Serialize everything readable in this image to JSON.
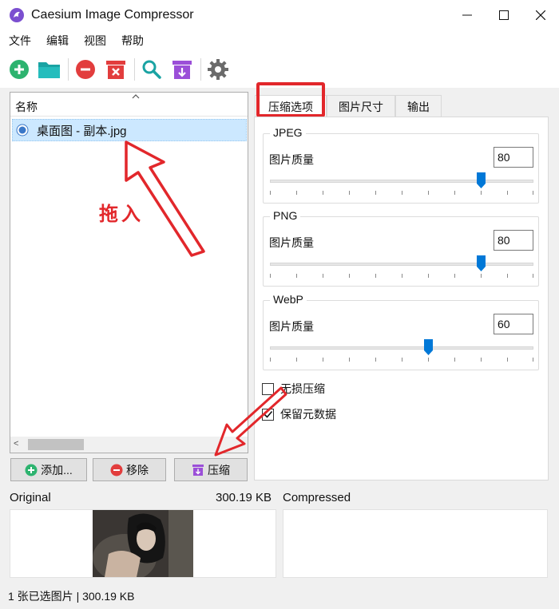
{
  "window": {
    "title": "Caesium Image Compressor"
  },
  "menu": [
    "文件",
    "编辑",
    "视图",
    "帮助"
  ],
  "toolbar": {
    "icons": [
      "add-icon",
      "folder-icon",
      "remove-icon",
      "clear-icon",
      "preview-search-icon",
      "compress-icon",
      "settings-icon"
    ],
    "colors": {
      "green": "#2db36f",
      "teal": "#1aa3a3",
      "red": "#e23d3d",
      "purple": "#9b4fd8",
      "gray": "#6b6b6b"
    }
  },
  "filelist": {
    "header": "名称",
    "rows": [
      {
        "name": "桌面图 - 副本.jpg"
      }
    ]
  },
  "actions": {
    "add_label": "添加...",
    "remove_label": "移除",
    "compress_label": "压缩"
  },
  "tabs": [
    {
      "label": "压缩选项",
      "active": true
    },
    {
      "label": "图片尺寸"
    },
    {
      "label": "输出"
    }
  ],
  "compression": {
    "groups": [
      {
        "title": "JPEG",
        "quality_label": "图片质量",
        "quality": "80",
        "slider_fraction": 0.8
      },
      {
        "title": "PNG",
        "quality_label": "图片质量",
        "quality": "80",
        "slider_fraction": 0.8
      },
      {
        "title": "WebP",
        "quality_label": "图片质量",
        "quality": "60",
        "slider_fraction": 0.6
      }
    ],
    "lossless_label": "无损压缩",
    "lossless_checked": false,
    "keep_metadata_label": "保留元数据",
    "keep_metadata_checked": true
  },
  "preview": {
    "original_label": "Original",
    "original_size": "300.19 KB",
    "compressed_label": "Compressed"
  },
  "status": {
    "text": "1 张已选图片 | 300.19 KB"
  },
  "annotation": {
    "text": "拖入",
    "color": "#e2272b"
  }
}
